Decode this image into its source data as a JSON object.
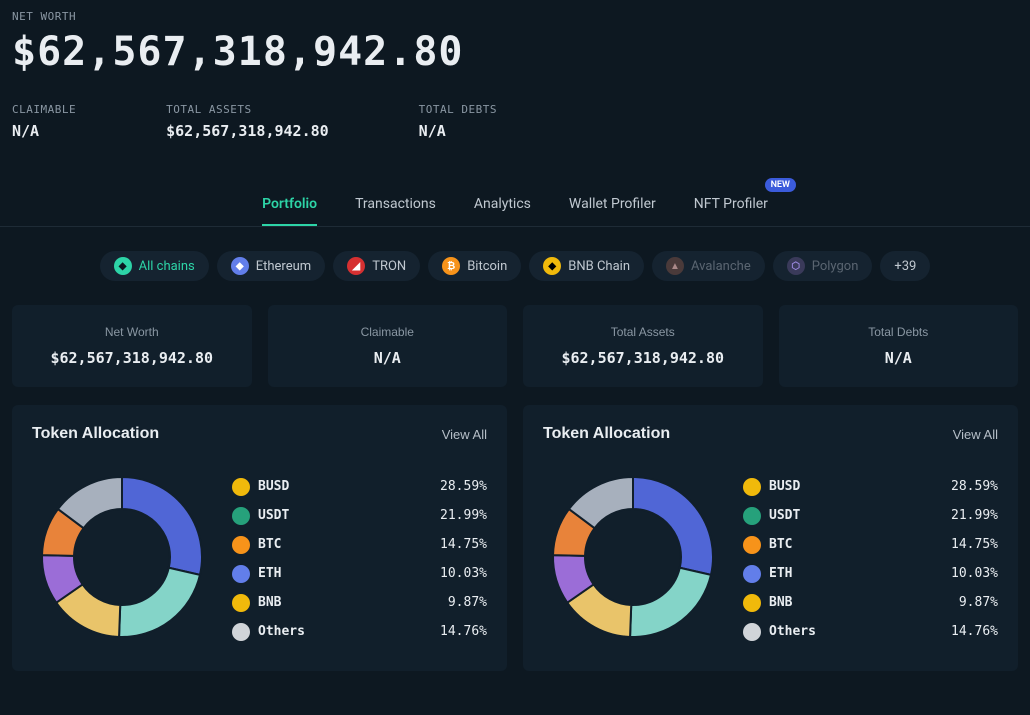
{
  "header": {
    "net_worth_label": "NET WORTH",
    "net_worth_value": "$62,567,318,942.80",
    "stats": [
      {
        "label": "CLAIMABLE",
        "value": "N/A"
      },
      {
        "label": "TOTAL ASSETS",
        "value": "$62,567,318,942.80"
      },
      {
        "label": "TOTAL DEBTS",
        "value": "N/A"
      }
    ]
  },
  "tabs": [
    {
      "label": "Portfolio",
      "active": true
    },
    {
      "label": "Transactions"
    },
    {
      "label": "Analytics"
    },
    {
      "label": "Wallet Profiler"
    },
    {
      "label": "NFT Profiler",
      "badge": "NEW"
    }
  ],
  "chains": [
    {
      "label": "All chains",
      "active": true,
      "icon_bg": "#2dd4a7",
      "icon_fg": "#0d1821",
      "glyph": "◆"
    },
    {
      "label": "Ethereum",
      "icon_bg": "#627eea",
      "icon_fg": "#fff",
      "glyph": "◆"
    },
    {
      "label": "TRON",
      "icon_bg": "#d63031",
      "icon_fg": "#fff",
      "glyph": "◢"
    },
    {
      "label": "Bitcoin",
      "icon_bg": "#f7931a",
      "icon_fg": "#fff",
      "glyph": "₿"
    },
    {
      "label": "BNB Chain",
      "icon_bg": "#f0b90b",
      "icon_fg": "#000",
      "glyph": "◆"
    },
    {
      "label": "Avalanche",
      "disabled": true,
      "icon_bg": "#4a3a3a",
      "icon_fg": "#a88",
      "glyph": "▲"
    },
    {
      "label": "Polygon",
      "disabled": true,
      "icon_bg": "#3a3a5a",
      "icon_fg": "#98d",
      "glyph": "⬡"
    }
  ],
  "chain_more": "+39",
  "cards": [
    {
      "label": "Net Worth",
      "value": "$62,567,318,942.80"
    },
    {
      "label": "Claimable",
      "value": "N/A"
    },
    {
      "label": "Total Assets",
      "value": "$62,567,318,942.80"
    },
    {
      "label": "Total Debts",
      "value": "N/A"
    }
  ],
  "alloc": {
    "title": "Token Allocation",
    "view_all": "View All",
    "tokens": [
      {
        "name": "BUSD",
        "pct": "28.59%",
        "color": "#f0b90b"
      },
      {
        "name": "USDT",
        "pct": "21.99%",
        "color": "#26a17b"
      },
      {
        "name": "BTC",
        "pct": "14.75%",
        "color": "#f7931a"
      },
      {
        "name": "ETH",
        "pct": "10.03%",
        "color": "#627eea"
      },
      {
        "name": "BNB",
        "pct": "9.87%",
        "color": "#f0b90b"
      },
      {
        "name": "Others",
        "pct": "14.76%",
        "color": "#d0d4d9"
      }
    ]
  },
  "chart_data": {
    "type": "pie",
    "title": "Token Allocation",
    "categories": [
      "BUSD",
      "USDT",
      "BTC",
      "ETH",
      "BNB",
      "Others"
    ],
    "values": [
      28.59,
      21.99,
      14.75,
      10.03,
      9.87,
      14.76
    ],
    "colors": [
      "#5066d6",
      "#84d4c8",
      "#e9c46a",
      "#9b6dd7",
      "#e8833a",
      "#a7b0bd"
    ]
  }
}
